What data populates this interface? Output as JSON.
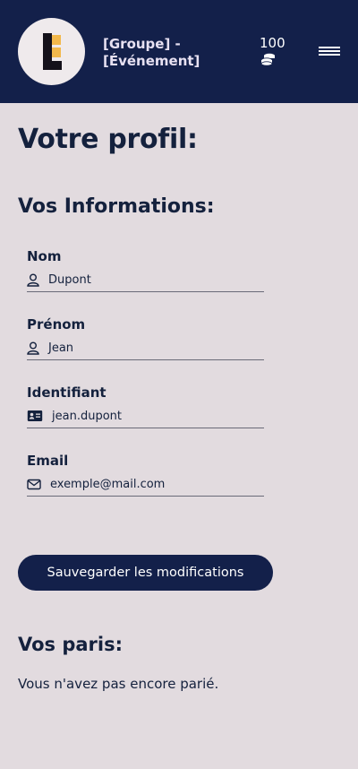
{
  "header": {
    "group_title": "[Groupe] - [Événement]",
    "coins_count": "100",
    "logo_icon": "brand-logo",
    "coins_icon": "coins-icon",
    "menu_icon": "hamburger-menu-icon"
  },
  "page": {
    "title": "Votre profil:"
  },
  "info": {
    "title": "Vos Informations:",
    "fields": [
      {
        "label": "Nom",
        "value": "Dupont",
        "icon": "user-icon"
      },
      {
        "label": "Prénom",
        "value": "Jean",
        "icon": "user-icon"
      },
      {
        "label": "Identifiant",
        "value": "jean.dupont",
        "icon": "id-card-icon"
      },
      {
        "label": "Email",
        "value": "exemple@mail.com",
        "icon": "envelope-icon"
      }
    ],
    "save_label": "Sauvegarder les modifications"
  },
  "bets": {
    "title": "Vos paris:",
    "empty_text": "Vous n'avez pas encore parié."
  },
  "colors": {
    "primary": "#13204a",
    "background": "#e2dbdf",
    "logo_accent": "#f2b84b"
  }
}
